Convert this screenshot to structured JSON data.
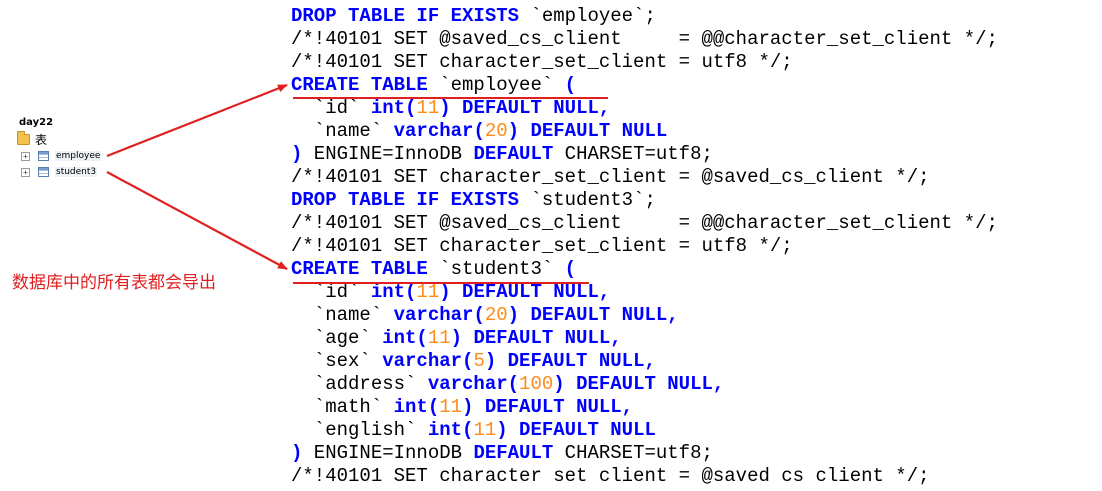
{
  "tree": {
    "database": "day22",
    "folder_label": "表",
    "expander_symbol": "+",
    "tables": [
      {
        "name": "employee",
        "icon": "table-icon"
      },
      {
        "name": "student3",
        "icon": "table-icon"
      }
    ]
  },
  "annotation": {
    "text": "数据库中的所有表都会导出",
    "color": "#e02020"
  },
  "code": {
    "keyword_color": "#0000ff",
    "number_color": "#ff8c1a",
    "lines": [
      [
        [
          "k",
          "DROP TABLE IF EXISTS"
        ],
        [
          "t",
          " `employee`;"
        ]
      ],
      [
        [
          "t",
          "/*!40101 SET @saved_cs_client     = @@character_set_client */;"
        ]
      ],
      [
        [
          "t",
          "/*!40101 SET character_set_client = utf8 */;"
        ]
      ],
      [
        [
          "k",
          "CREATE TABLE"
        ],
        [
          "t",
          " `employee` "
        ],
        [
          "k",
          "("
        ]
      ],
      [
        [
          "t",
          "  `id` "
        ],
        [
          "k",
          "int("
        ],
        [
          "n",
          "11"
        ],
        [
          "k",
          ") DEFAULT NULL,"
        ]
      ],
      [
        [
          "t",
          "  `name` "
        ],
        [
          "k",
          "varchar("
        ],
        [
          "n",
          "20"
        ],
        [
          "k",
          ") DEFAULT NULL"
        ]
      ],
      [
        [
          "k",
          ")"
        ],
        [
          "t",
          " ENGINE=InnoDB "
        ],
        [
          "k",
          "DEFAULT"
        ],
        [
          "t",
          " CHARSET=utf8;"
        ]
      ],
      [
        [
          "t",
          "/*!40101 SET character_set_client = @saved_cs_client */;"
        ]
      ],
      [
        [
          "k",
          "DROP TABLE IF EXISTS"
        ],
        [
          "t",
          " `student3`;"
        ]
      ],
      [
        [
          "t",
          "/*!40101 SET @saved_cs_client     = @@character_set_client */;"
        ]
      ],
      [
        [
          "t",
          "/*!40101 SET character_set_client = utf8 */;"
        ]
      ],
      [
        [
          "k",
          "CREATE TABLE"
        ],
        [
          "t",
          " `student3` "
        ],
        [
          "k",
          "("
        ]
      ],
      [
        [
          "t",
          "  `id` "
        ],
        [
          "k",
          "int("
        ],
        [
          "n",
          "11"
        ],
        [
          "k",
          ") DEFAULT NULL,"
        ]
      ],
      [
        [
          "t",
          "  `name` "
        ],
        [
          "k",
          "varchar("
        ],
        [
          "n",
          "20"
        ],
        [
          "k",
          ") DEFAULT NULL,"
        ]
      ],
      [
        [
          "t",
          "  `age` "
        ],
        [
          "k",
          "int("
        ],
        [
          "n",
          "11"
        ],
        [
          "k",
          ") DEFAULT NULL,"
        ]
      ],
      [
        [
          "t",
          "  `sex` "
        ],
        [
          "k",
          "varchar("
        ],
        [
          "n",
          "5"
        ],
        [
          "k",
          ") DEFAULT NULL,"
        ]
      ],
      [
        [
          "t",
          "  `address` "
        ],
        [
          "k",
          "varchar("
        ],
        [
          "n",
          "100"
        ],
        [
          "k",
          ") DEFAULT NULL,"
        ]
      ],
      [
        [
          "t",
          "  `math` "
        ],
        [
          "k",
          "int("
        ],
        [
          "n",
          "11"
        ],
        [
          "k",
          ") DEFAULT NULL,"
        ]
      ],
      [
        [
          "t",
          "  `english` "
        ],
        [
          "k",
          "int("
        ],
        [
          "n",
          "11"
        ],
        [
          "k",
          ") DEFAULT NULL"
        ]
      ],
      [
        [
          "k",
          ")"
        ],
        [
          "t",
          " ENGINE=InnoDB "
        ],
        [
          "k",
          "DEFAULT"
        ],
        [
          "t",
          " CHARSET=utf8;"
        ]
      ],
      [
        [
          "t",
          "/*!40101 SET character set client = @saved cs client */;"
        ]
      ]
    ]
  }
}
